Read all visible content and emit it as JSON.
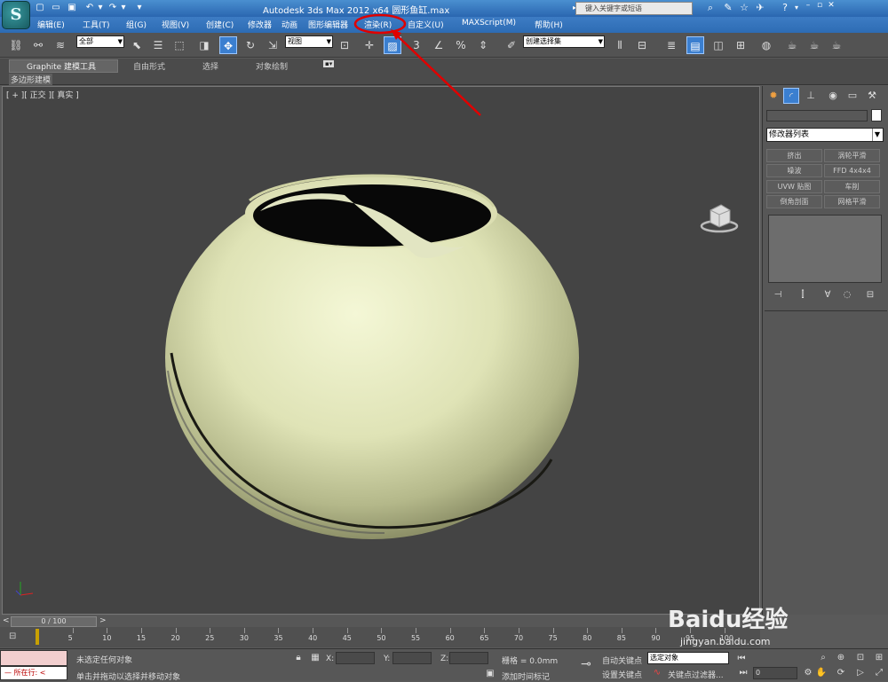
{
  "titlebar": {
    "app_icon": "3ds-max-logo",
    "title_main": "Autodesk 3ds Max  2012 x64",
    "title_file": "圆形鱼缸.max",
    "search_placeholder": "键入关键字或短语"
  },
  "menubar": {
    "items": [
      "编辑(E)",
      "工具(T)",
      "组(G)",
      "视图(V)",
      "创建(C)",
      "修改器",
      "动画",
      "图形编辑器",
      "渲染(R)",
      "自定义(U)",
      "MAXScript(M)",
      "帮助(H)"
    ],
    "highlighted": "渲染(R)"
  },
  "toolbar": {
    "selection_filter": "全部",
    "ref_coord": "视图",
    "named_selection": "创建选择集"
  },
  "ribbon": {
    "tabs": [
      "Graphite 建模工具",
      "自由形式",
      "选择",
      "对象绘制"
    ],
    "sub_label": "多边形建模"
  },
  "viewport": {
    "label": "[ + ][ 正交 ][ 真实 ]",
    "object": "fish-bowl-sphere",
    "object_color": "#e6ebc2",
    "background_color": "#444444"
  },
  "command_panel": {
    "modifier_list": "修改器列表",
    "modifier_buttons": [
      "挤出",
      "涡轮平滑",
      "噪波",
      "FFD 4x4x4",
      "UVW 贴图",
      "车削",
      "倒角剖面",
      "网格平滑"
    ]
  },
  "timeline": {
    "slider": "0 / 100",
    "ticks": [
      "5",
      "10",
      "15",
      "20",
      "25",
      "30",
      "35",
      "40",
      "45",
      "50",
      "55",
      "60",
      "65",
      "70",
      "75",
      "80",
      "85",
      "90",
      "95",
      "100"
    ]
  },
  "statusbar": {
    "maxscript_label": "所在行:",
    "status_line1": "未选定任何对象",
    "status_line2": "单击并拖动以选择并移动对象",
    "x_label": "X:",
    "y_label": "Y:",
    "z_label": "Z:",
    "grid": "栅格 = 0.0mm",
    "add_time_tag": "添加时间标记",
    "auto_key": "自动关键点",
    "set_key": "设置关键点",
    "selection_set": "选定对象",
    "key_filters": "关键点过滤器...",
    "frame": "0"
  },
  "watermark": {
    "brand": "Baidu经验",
    "url": "jingyan.baidu.com"
  },
  "annotation": {
    "color": "#e00000"
  }
}
